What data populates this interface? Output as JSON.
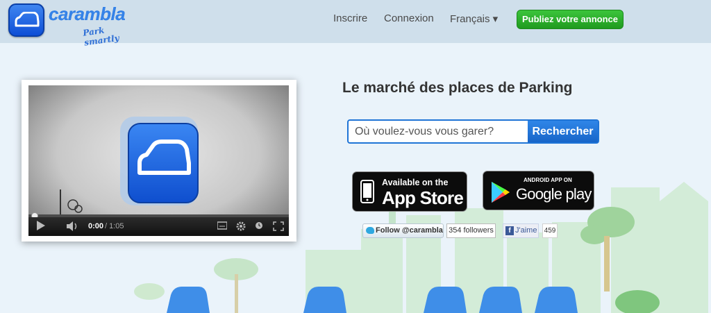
{
  "header": {
    "logo_text": "carambla",
    "logo_tagline": "Park smartly",
    "nav": {
      "inscrire": "Inscrire",
      "connexion": "Connexion",
      "language": "Français ▾"
    },
    "publish_button": "Publiez votre annonce"
  },
  "video": {
    "time_current": "0:00",
    "time_total": "/ 1:05",
    "progress": 0
  },
  "main": {
    "headline": "Le marché des places de Parking",
    "search": {
      "placeholder": "Où voulez-vous vous garer?",
      "value": "",
      "button": "Rechercher"
    },
    "app_store": {
      "small": "Available on the",
      "big": "App Store"
    },
    "google_play": {
      "small": "ANDROID APP ON",
      "big": "Google play"
    },
    "social": {
      "twitter_button": "Follow @carambla",
      "twitter_count": "354 followers",
      "facebook_button": "J'aime",
      "facebook_count": "459"
    }
  },
  "colors": {
    "brand_blue": "#1f74d6",
    "publish_green": "#2aae2a",
    "header_bg": "#cfdfeb",
    "page_bg": "#eaf3fa"
  }
}
